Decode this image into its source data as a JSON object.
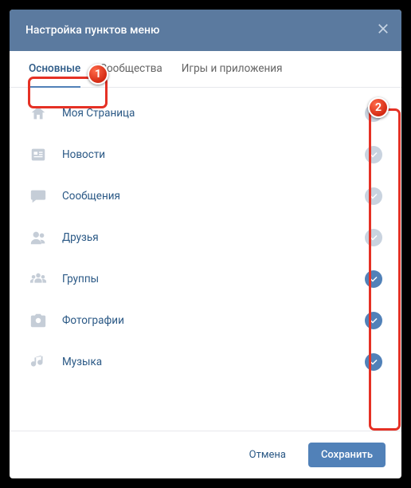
{
  "header": {
    "title": "Настройка пунктов меню"
  },
  "tabs": [
    {
      "label": "Основные",
      "active": true
    },
    {
      "label": "Сообщества",
      "active": false
    },
    {
      "label": "Игры и приложения",
      "active": false
    }
  ],
  "items": [
    {
      "icon": "home",
      "label": "Моя Страница",
      "checked": false
    },
    {
      "icon": "news",
      "label": "Новости",
      "checked": false
    },
    {
      "icon": "message",
      "label": "Сообщения",
      "checked": false
    },
    {
      "icon": "friends",
      "label": "Друзья",
      "checked": false
    },
    {
      "icon": "groups",
      "label": "Группы",
      "checked": true
    },
    {
      "icon": "photos",
      "label": "Фотографии",
      "checked": true
    },
    {
      "icon": "music",
      "label": "Музыка",
      "checked": true
    }
  ],
  "footer": {
    "cancel": "Отмена",
    "save": "Сохранить"
  },
  "annotations": {
    "1": "1",
    "2": "2"
  },
  "colors": {
    "accent": "#5181b8",
    "header": "#5b7a9f",
    "annotation": "#e53125"
  }
}
